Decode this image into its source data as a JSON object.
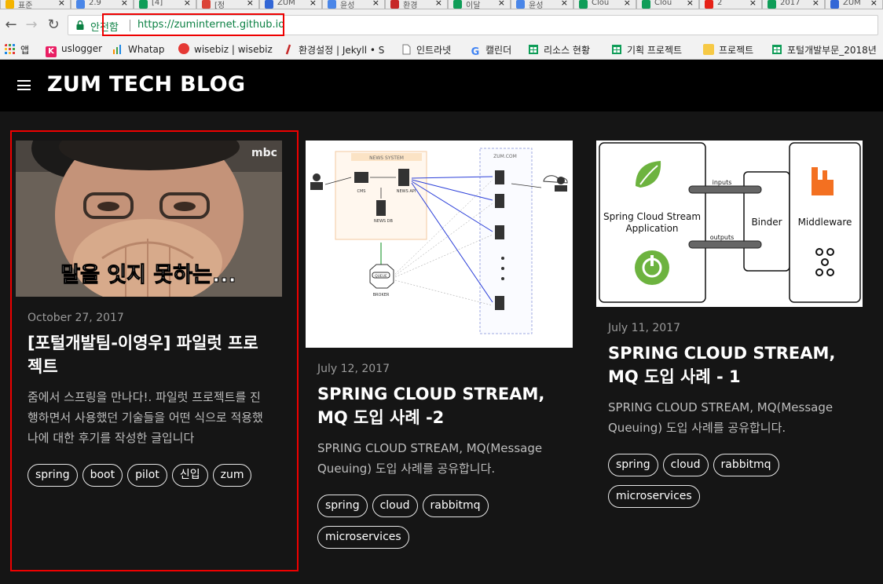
{
  "browser": {
    "tabs": [
      {
        "label": "표준",
        "icon_color": "#f4b400"
      },
      {
        "label": "2.9",
        "icon_color": "#4a86e8"
      },
      {
        "label": "[4]",
        "icon_color": "#0f9d58"
      },
      {
        "label": "[정",
        "icon_color": "#db4437"
      },
      {
        "label": "ZUM",
        "icon_color": "#3367d6"
      },
      {
        "label": "윤성",
        "icon_color": "#4a86e8"
      },
      {
        "label": "환경",
        "icon_color": "#c62828"
      },
      {
        "label": "이달",
        "icon_color": "#0f9d58"
      },
      {
        "label": "윤성",
        "icon_color": "#4a86e8"
      },
      {
        "label": "Clou",
        "icon_color": "#0f9d58"
      },
      {
        "label": "Clou",
        "icon_color": "#0f9d58"
      },
      {
        "label": "2",
        "icon_color": "#e62117"
      },
      {
        "label": "2017",
        "icon_color": "#0f9d58"
      },
      {
        "label": "ZUM",
        "icon_color": "#3367d6"
      }
    ],
    "tab_close": "×",
    "nav": {
      "back": "←",
      "forward": "→",
      "reload": "↻"
    },
    "security_label": "안전함",
    "url": "https://zuminternet.github.io",
    "bookmarks": [
      {
        "label": "앱",
        "icon": "apps-icon",
        "color": "#e53935"
      },
      {
        "label": "uslogger",
        "icon": "k-icon",
        "color": "#e91e63"
      },
      {
        "label": "Whatap",
        "icon": "bars-icon",
        "color": "#fb8c00"
      },
      {
        "label": "wisebiz | wisebiz",
        "icon": "wisebiz-icon",
        "color": "#e53935"
      },
      {
        "label": "환경설정 | Jekyll • S",
        "icon": "jekyll-icon",
        "color": "#c62828"
      },
      {
        "label": "인트라넷",
        "icon": "page-icon",
        "color": "#9e9e9e"
      },
      {
        "label": "캘린더",
        "icon": "g-icon",
        "color": "#4285f4"
      },
      {
        "label": "리소스 현황",
        "icon": "sheet-icon",
        "color": "#0f9d58"
      },
      {
        "label": "기획 프로젝트",
        "icon": "sheet-icon",
        "color": "#0f9d58"
      },
      {
        "label": "프로젝트",
        "icon": "folder-icon",
        "color": "#f6c945"
      },
      {
        "label": "포털개발부문_2018년",
        "icon": "sheet-icon",
        "color": "#0f9d58"
      }
    ]
  },
  "site": {
    "title": "ZUM TECH BLOG"
  },
  "posts": [
    {
      "date": "October 27, 2017",
      "title": "[포털개발팀-이영우] 파일럿 프로젝트",
      "excerpt": "줌에서 스프링을 만나다!. 파일럿 프로젝트를 진행하면서 사용했던 기술들을 어떤 식으로 적용했나에 대한 후기를 작성한 글입니다",
      "image": {
        "caption": "말을 잇지 못하는...",
        "watermark": "mbc"
      },
      "tags": [
        "spring",
        "boot",
        "pilot",
        "신입",
        "zum"
      ]
    },
    {
      "date": "July 12, 2017",
      "title": "SPRING CLOUD STREAM, MQ 도입 사례 -2",
      "excerpt": "SPRING CLOUD STREAM, MQ(Message Queuing) 도입 사례를 공유합니다.",
      "image": {
        "news_system": "NEWS SYSTEM",
        "cms": "CMS",
        "news_api": "NEWS API",
        "news_db": "NEWS DB",
        "queue": "QUEUE",
        "broker": "BROKER",
        "zum": "ZUM.COM"
      },
      "tags": [
        "spring",
        "cloud",
        "rabbitmq",
        "microservices"
      ]
    },
    {
      "date": "July 11, 2017",
      "title": "SPRING CLOUD STREAM, MQ 도입 사례 - 1",
      "excerpt": "SPRING CLOUD STREAM, MQ(Message Queuing) 도입 사례를 공유합니다.",
      "image": {
        "app_line1": "Spring Cloud Stream",
        "app_line2": "Application",
        "inputs": "inputs",
        "outputs": "outputs",
        "binder": "Binder",
        "middleware": "Middleware"
      },
      "tags": [
        "spring",
        "cloud",
        "rabbitmq",
        "microservices"
      ]
    }
  ]
}
